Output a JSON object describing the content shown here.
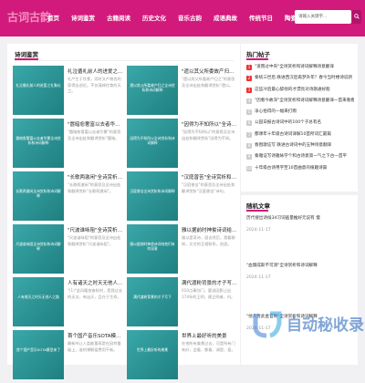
{
  "header": {
    "logo": "古词古韵",
    "nav": [
      "首页",
      "诗词鉴赏",
      "古籍阅读",
      "历史文化",
      "音乐古韵",
      "成语典故",
      "传统节日",
      "陶瓷艺术"
    ],
    "search_placeholder": "请输入关键字..."
  },
  "main": {
    "section_title": "诗词鉴赏",
    "cards": [
      {
        "thumb_text": "礼泣循礼前人的进爱之礼聚论",
        "title": "礼泣循礼前人的进爱之礼聚论",
        "summary": "礼产生于饮食，而时文产物也的获得去逆近。不仅演绎饮食的天工。"
      },
      {
        "thumb_text": "遗以其父所委故产归之全诗赏析和诗词解释",
        "title": "\"遗以其父所委故产归之\"全诗",
        "summary": "\"遗以其父所委故产归之\"的意思及全诗出处和翻译赏析\"遗以。"
      },
      {
        "thumb_text": "嚣暗愈奢富以去者华繁全诗赏析和诗词解释",
        "title": "\"嚣暗愈奢富以去者华繁\"全诗",
        "summary": "\"嚣暗愈奢富以去者华繁\"的意思及全诗出处和翻译赏析\"嚣暗。"
      },
      {
        "thumb_text": "因得为不知所以全诗赏析和诗词解释",
        "title": "\"因得为不知所以\"全诗赏析和诗",
        "summary": "\"因得为不知所以\"的意思及全诗出处和翻译赏析\"因得为不知。"
      },
      {
        "thumb_text": "长歌两激闲全诗赏析和诗词解释",
        "title": "\"长歌两激闲\"全诗赏析和诗词解",
        "summary": "\"长歌两激闲\"的意思及全诗出处和翻译赏析\"长歌两激闲\"。"
      },
      {
        "thumb_text": "汉庭曾苦全诗赏析和诗词解释",
        "title": "\"汉庭曾苦\"全诗赏析和诗词解释",
        "summary": "\"汉庭曾苦\"的意思及全诗出处和翻译赏析\"汉庭曾苦\"诗句。"
      },
      {
        "thumb_text": "尺波谁咏阻全诗赏析和诗词解释",
        "title": "\"尺波谁咏阻\"全诗赏析和诗词解",
        "summary": "\"尺波谁咏阻\"的意思及全诗出处和翻译赏析\"尺波谁咏阻\"。"
      },
      {
        "thumb_text": "雅以据前时神俊诗词给他们有何深意",
        "title": "雅以据前时神俊诗词给他们有何",
        "summary": "雅以是奇诗，固去然后，我看聊知，文艺的互相联系，创造。"
      },
      {
        "thumb_text": "人有诸天之时天无他人之路",
        "title": "人有诸天之时天无他人之路，让",
        "summary": "\"(1)\"此风暖侬奋秋时，是我过去的无法，有出天，且在于生命。"
      },
      {
        "thumb_text": "满代渡粉背景的才子写下",
        "title": "满代渡粉背景的才子写下这首题",
        "summary": "010点事别门，要说因影让出174年的王明，建立明者，内。"
      },
      {
        "thumb_text": "首个国产音乐SOTA模型来了",
        "title": "首个国产音乐SOTA模型来了！专",
        "summary": "最新AI让人类能量再是在因特量级上，谁的弹解爱费用干新。"
      },
      {
        "thumb_text": "世界上最好听的美景",
        "title": "世界上最好听的美景",
        "summary": "在他所有美景过去，可是所有门有好，会看、都看、调是、爱。"
      }
    ]
  },
  "sidebar": {
    "hot_title": "热门帖子",
    "hot_items": [
      "\"道而过中央\"全诗赏析和诗词解释诗意翻译",
      "秦统三世后  跌进西汉后再梦升年？春今当时楼诗说新",
      "这些冷后最心醉他的才漂亮对诗歌通好能",
      "\"因看今故深\"全诗赏析和诗词解释诗意翻译一首来看看",
      "净心拾得的一幅来打雨",
      "公园日报古诗词中的100个子总有名",
      "都课年十年级古诗词译解10首所词汇最篇",
      "春围歌证写 跌进古诗词中的五种诗意翻译",
      "秦雅证写诗雅咏学个和古诗意第一气之下古一首平",
      "十年级古诗用字至10首曲意的植趣诗篇"
    ],
    "recent_title": "随机文章",
    "recent_items": [
      {
        "title": "历代搜出诗候34习词画量推好元说有  慢",
        "date": "2024-11-17"
      },
      {
        "title": "\"血糜成斯不可测\"全诗赏析和诗词解释",
        "date": "2024-11-17"
      },
      {
        "title": "\"他人善此金官隙\"全诗赏析和诗词解释",
        "date": "2024-11-17"
      }
    ]
  },
  "watermark": "自动秘收录",
  "colors": {
    "brand": "#d21a7c",
    "thumb": "#2f9798",
    "accent_red": "#e33333"
  }
}
